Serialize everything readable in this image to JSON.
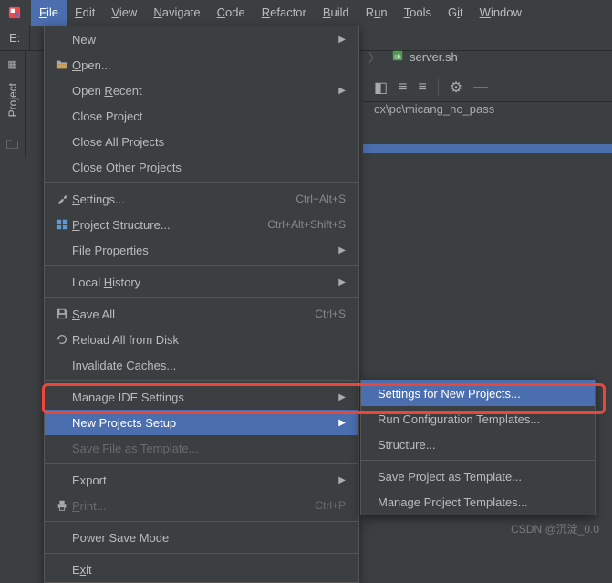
{
  "menubar": {
    "items": [
      {
        "label": "File",
        "underline": "F",
        "active": true
      },
      {
        "label": "Edit",
        "underline": "E"
      },
      {
        "label": "View",
        "underline": "V"
      },
      {
        "label": "Navigate",
        "underline": "N"
      },
      {
        "label": "Code",
        "underline": "C"
      },
      {
        "label": "Refactor",
        "underline": "R"
      },
      {
        "label": "Build",
        "underline": "B"
      },
      {
        "label": "Run",
        "underline": "u"
      },
      {
        "label": "Tools",
        "underline": "T"
      },
      {
        "label": "Git",
        "underline": "i"
      },
      {
        "label": "Window",
        "underline": "W"
      }
    ]
  },
  "drive": "E:",
  "tab": {
    "sep": "〉",
    "icon": "sh",
    "name": "server.sh"
  },
  "path_fragment": "cx\\pc\\micang_no_pass",
  "sidebar": {
    "label": "Project"
  },
  "file_menu": {
    "items": [
      {
        "label": "New",
        "submenu": true
      },
      {
        "label": "Open...",
        "underline": "O",
        "icon": "open"
      },
      {
        "label": "Open Recent",
        "underline": "R",
        "submenu": true
      },
      {
        "label": "Close Project"
      },
      {
        "label": "Close All Projects"
      },
      {
        "label": "Close Other Projects"
      },
      {
        "sep": true
      },
      {
        "label": "Settings...",
        "underline": "S",
        "shortcut": "Ctrl+Alt+S",
        "icon": "wrench"
      },
      {
        "label": "Project Structure...",
        "underline": "P",
        "shortcut": "Ctrl+Alt+Shift+S",
        "icon": "structure"
      },
      {
        "label": "File Properties",
        "submenu": true
      },
      {
        "sep": true
      },
      {
        "label": "Local History",
        "underline": "H",
        "submenu": true
      },
      {
        "sep": true
      },
      {
        "label": "Save All",
        "underline": "S",
        "shortcut": "Ctrl+S",
        "icon": "save"
      },
      {
        "label": "Reload All from Disk",
        "icon": "reload"
      },
      {
        "label": "Invalidate Caches..."
      },
      {
        "sep": true
      },
      {
        "label": "Manage IDE Settings",
        "submenu": true
      },
      {
        "label": "New Projects Setup",
        "submenu": true,
        "hovered": true
      },
      {
        "label": "Save File as Template...",
        "disabled": true
      },
      {
        "sep": true
      },
      {
        "label": "Export",
        "submenu": true
      },
      {
        "label": "Print...",
        "underline": "P",
        "shortcut": "Ctrl+P",
        "icon": "print",
        "disabled": true
      },
      {
        "sep": true
      },
      {
        "label": "Power Save Mode"
      },
      {
        "sep": true
      },
      {
        "label": "Exit",
        "underline": "x"
      }
    ]
  },
  "submenu": {
    "items": [
      {
        "label": "Settings for New Projects...",
        "hovered": true
      },
      {
        "label": "Run Configuration Templates..."
      },
      {
        "label": "Structure..."
      },
      {
        "sep": true
      },
      {
        "label": "Save Project as Template..."
      },
      {
        "label": "Manage Project Templates..."
      }
    ]
  },
  "watermark": "CSDN @沉淀_0.0"
}
